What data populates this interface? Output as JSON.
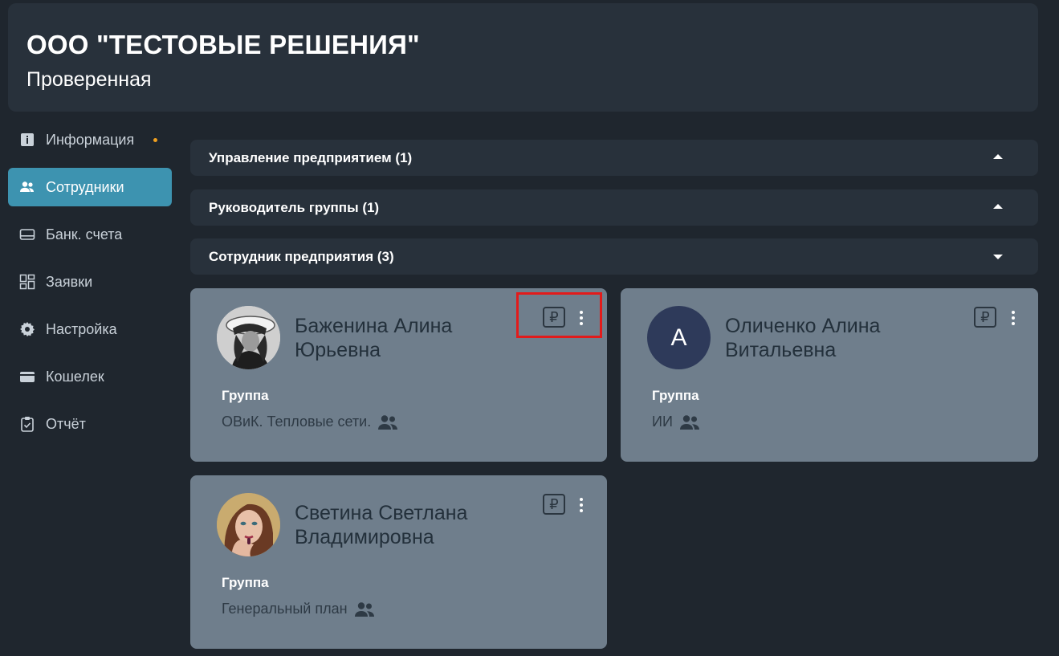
{
  "header": {
    "title": "ООО \"ТЕСТОВЫЕ РЕШЕНИЯ\"",
    "subtitle": "Проверенная"
  },
  "sidebar": {
    "items": [
      {
        "label": "Информация",
        "icon": "info-icon",
        "has_dot": true,
        "active": false
      },
      {
        "label": "Сотрудники",
        "icon": "users-icon",
        "active": true
      },
      {
        "label": "Банк. счета",
        "icon": "card-icon",
        "active": false
      },
      {
        "label": "Заявки",
        "icon": "grid-icon",
        "active": false
      },
      {
        "label": "Настройка",
        "icon": "gear-icon",
        "active": false
      },
      {
        "label": "Кошелек",
        "icon": "wallet-icon",
        "active": false
      },
      {
        "label": "Отчёт",
        "icon": "clipboard-icon",
        "active": false
      }
    ]
  },
  "sections": [
    {
      "label": "Управление предприятием (1)",
      "expanded": false
    },
    {
      "label": "Руководитель группы (1)",
      "expanded": false
    },
    {
      "label": "Сотрудник предприятия (3)",
      "expanded": true
    }
  ],
  "employees": [
    {
      "name": "Баженина Алина Юрьевна",
      "group_label": "Группа",
      "group": "ОВиК. Тепловые сети.",
      "currency_symbol": "₽",
      "avatar": "photo"
    },
    {
      "name": "Оличенко Алина Витальевна",
      "group_label": "Группа",
      "group": "ИИ",
      "currency_symbol": "₽",
      "avatar_letter": "А"
    },
    {
      "name": "Светина Светлана Владимировна",
      "group_label": "Группа",
      "group": "Генеральный план",
      "currency_symbol": "₽",
      "avatar": "photo"
    }
  ],
  "colors": {
    "background": "#1f262e",
    "panel": "#28313b",
    "active_nav": "#3d93b0",
    "card": "#6f7e8c",
    "highlight": "#e21b1b",
    "dot": "#f0a020"
  }
}
